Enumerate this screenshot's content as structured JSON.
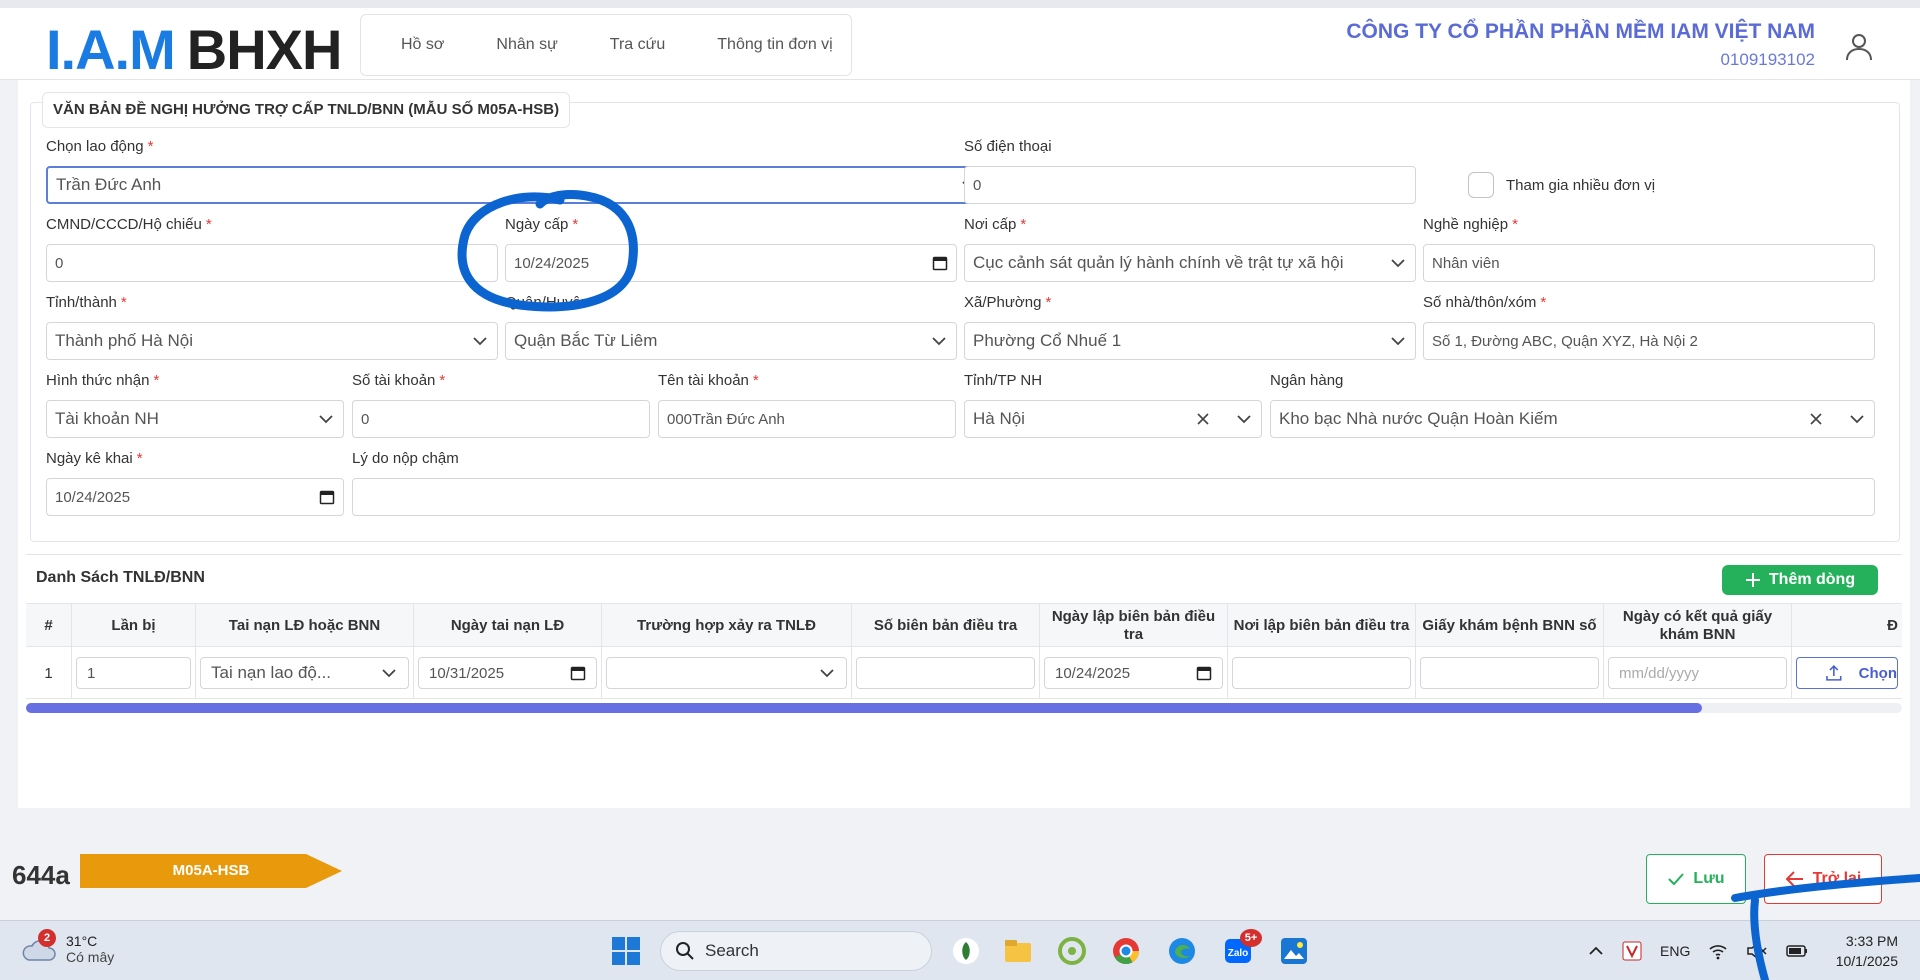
{
  "header": {
    "logo_part1": "I.A.M",
    "logo_part2": "BHXH",
    "nav": [
      "Hồ sơ",
      "Nhân sự",
      "Tra cứu",
      "Thông tin đơn vị"
    ],
    "company_name": "CÔNG TY CỔ PHẦN PHẦN MỀM IAM VIỆT NAM",
    "tax_code": "0109193102"
  },
  "form": {
    "section_title": "VĂN BẢN ĐỀ NGHỊ HƯỞNG TRỢ CẤP TNLD/BNN (MẪU SỐ M05A-HSB)",
    "required_mark": "*",
    "chon_lao_dong": {
      "label": "Chọn lao động",
      "value": "Trần Đức Anh"
    },
    "so_dien_thoai": {
      "label": "Số điện thoại",
      "value": "0"
    },
    "tham_gia": {
      "label": "Tham gia nhiều đơn vị"
    },
    "cmnd": {
      "label": "CMND/CCCD/Hộ chiếu",
      "value": "0"
    },
    "ngay_cap": {
      "label": "Ngày cấp",
      "value": "10/24/2025"
    },
    "noi_cap": {
      "label": "Nơi cấp",
      "value": "Cục cảnh sát quản lý hành chính về trật tự xã hội"
    },
    "nghe_nghiep": {
      "label": "Nghề nghiệp",
      "value": "Nhân viên"
    },
    "tinh_thanh": {
      "label": "Tỉnh/thành",
      "value": "Thành phố Hà Nội"
    },
    "quan_huyen": {
      "label": "Quận/Huyện",
      "value": "Quận Bắc Từ Liêm"
    },
    "xa_phuong": {
      "label": "Xã/Phường",
      "value": "Phường Cổ Nhuế 1"
    },
    "so_nha": {
      "label": "Số nhà/thôn/xóm",
      "value": "Số 1, Đường ABC, Quận XYZ, Hà Nội 2"
    },
    "hinh_thuc_nhan": {
      "label": "Hình thức nhận",
      "value": "Tài khoản NH"
    },
    "so_tai_khoan": {
      "label": "Số tài khoản",
      "value": "0"
    },
    "ten_tai_khoan": {
      "label": "Tên tài khoản",
      "value": "000Trần Đức Anh"
    },
    "tinh_tp_nh": {
      "label": "Tỉnh/TP NH",
      "value": "Hà Nội"
    },
    "ngan_hang": {
      "label": "Ngân hàng",
      "value": "Kho bạc Nhà nước Quận Hoàn Kiếm"
    },
    "ngay_ke_khai": {
      "label": "Ngày kê khai",
      "value": "10/24/2025"
    },
    "ly_do": {
      "label": "Lý do nộp chậm",
      "value": ""
    }
  },
  "table": {
    "title": "Danh Sách TNLĐ/BNN",
    "add_label": "Thêm dòng",
    "headers": [
      "#",
      "Lần bị",
      "Tai nạn LĐ hoặc BNN",
      "Ngày tai nạn LĐ",
      "Trường hợp xảy ra TNLĐ",
      "Số biên bản điều tra",
      "Ngày lập biên bản điều tra",
      "Nơi lập biên bản điều tra",
      "Giấy khám bệnh BNN số",
      "Ngày có kết quả giấy khám BNN",
      "Đ"
    ],
    "row": {
      "index": "1",
      "lan_bi": "1",
      "loai": "Tai nạn lao độ...",
      "ngay_tai_nan": "10/31/2025",
      "truong_hop": "",
      "so_bien_ban": "",
      "ngay_lap": "10/24/2025",
      "noi_lap": "",
      "giay_kham": "",
      "ngay_ket_qua_placeholder": "mm/dd/yyyy",
      "choose_label": "Chọn"
    }
  },
  "footer": {
    "doc_number": "644a",
    "doc_code": "M05A-HSB",
    "save_label": "Lưu",
    "back_label": "Trở lại"
  },
  "taskbar": {
    "weather_badge": "2",
    "temperature": "31°C",
    "weather_desc": "Có mây",
    "search_label": "Search",
    "zalo_badge": "5+",
    "lang": "ENG",
    "time": "3:33 PM",
    "date": "10/1/2025"
  },
  "colors": {
    "brand_blue": "#1a7be3",
    "company_purple": "#5a6bd6",
    "primary_green": "#25b15b",
    "danger_red": "#e53935",
    "tag_orange": "#e8990c",
    "annotation_blue": "#0b64d0"
  }
}
